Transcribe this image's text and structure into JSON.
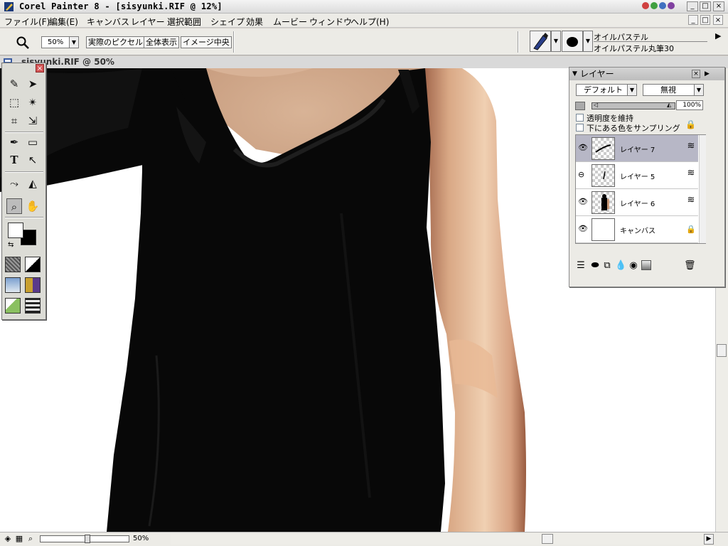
{
  "window": {
    "title": "Corel Painter 8 - [sisyunki.RIF @ 12%]",
    "minimize": "_",
    "maximize": "□",
    "close": "×"
  },
  "menu": {
    "items": [
      "ファイル(F)",
      "編集(E)",
      "キャンバス",
      "レイヤー",
      "選択範囲",
      "シェイプ",
      "効果",
      "ムービー",
      "ウィンドウ",
      "ヘルプ(H)"
    ]
  },
  "propbar": {
    "zoom_value": "50%",
    "actual_pixels": "実際のピクセル",
    "fit_screen": "全体表示",
    "center_image": "イメージ中央",
    "brush_category": "オイルパステル",
    "brush_variant": "オイルパステル丸筆30"
  },
  "document": {
    "title": "sisyunki.RIF @ 50%"
  },
  "status": {
    "zoom_value": "50%"
  },
  "layers_panel": {
    "title": "レイヤー",
    "composite_method": "デフォルト",
    "composite_depth": "無視",
    "opacity": "100%",
    "preserve_transparency": "透明度を維持",
    "pick_up_underlying": "下にある色をサンプリング",
    "rows": [
      {
        "name": "レイヤー 7",
        "active": true
      },
      {
        "name": "レイヤー 5",
        "active": false
      },
      {
        "name": "レイヤー 6",
        "active": false
      },
      {
        "name": "キャンバス",
        "active": false
      }
    ]
  },
  "colors": {
    "primary": "#ffffff",
    "secondary": "#000000",
    "active_layer": "#b7b7c6"
  }
}
